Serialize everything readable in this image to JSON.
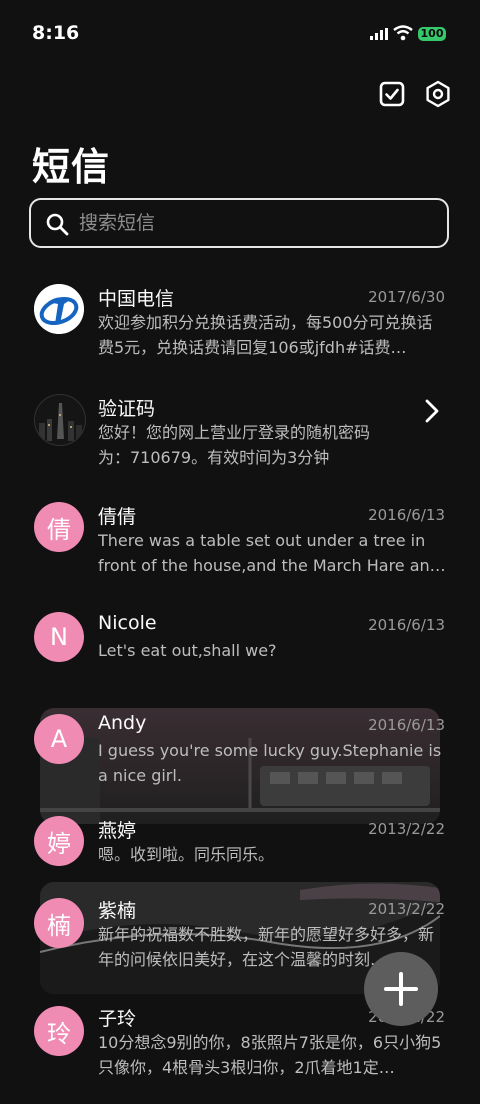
{
  "status_bar": {
    "time": "8:16",
    "battery": "100"
  },
  "header": {
    "title": "短信",
    "icons": [
      "check-square-icon",
      "settings-hex-icon"
    ]
  },
  "search": {
    "placeholder": "搜索短信"
  },
  "conversations": [
    {
      "name": "中国电信",
      "date": "2017/6/30",
      "preview": "欢迎参加积分兑换话费活动，每500分可兑换话费5元，兑换话费请回复106或jfdh#话费…",
      "avatar_type": "telecom-logo"
    },
    {
      "name": "验证码",
      "date": "",
      "preview": "您好！您的网上营业厅登录的随机密码为：710679。有效时间为3分钟",
      "avatar_type": "city-photo"
    },
    {
      "name": "倩倩",
      "date": "2016/6/13",
      "preview": "There was a table set out under a tree in front of the house,and the March Hare an…",
      "avatar_letter": "倩"
    },
    {
      "name": "Nicole",
      "date": "2016/6/13",
      "preview": "Let's eat out,shall we?",
      "avatar_letter": "N"
    },
    {
      "name": "Andy",
      "date": "2016/6/13",
      "preview": "I guess you're some lucky guy.Stephanie is a nice girl.",
      "avatar_letter": "A"
    },
    {
      "name": "燕婷",
      "date": "2013/2/22",
      "preview": "嗯。收到啦。同乐同乐。",
      "avatar_letter": "婷"
    },
    {
      "name": "紫楠",
      "date": "2013/2/22",
      "preview": "新年的祝福数不胜数，新年的愿望好多好多，新年的问候依旧美好，在这个温馨的时刻…",
      "avatar_letter": "楠"
    },
    {
      "name": "子玲",
      "date": "2013/2/22",
      "preview": "10分想念9别的你，8张照片7张是你，6只小狗5只像你，4根骨头3根归你，2爪着地1定…",
      "avatar_letter": "玲"
    }
  ],
  "colors": {
    "avatar_pink": "#f08cb3",
    "background": "#111111",
    "fab": "#5d5d5d"
  }
}
